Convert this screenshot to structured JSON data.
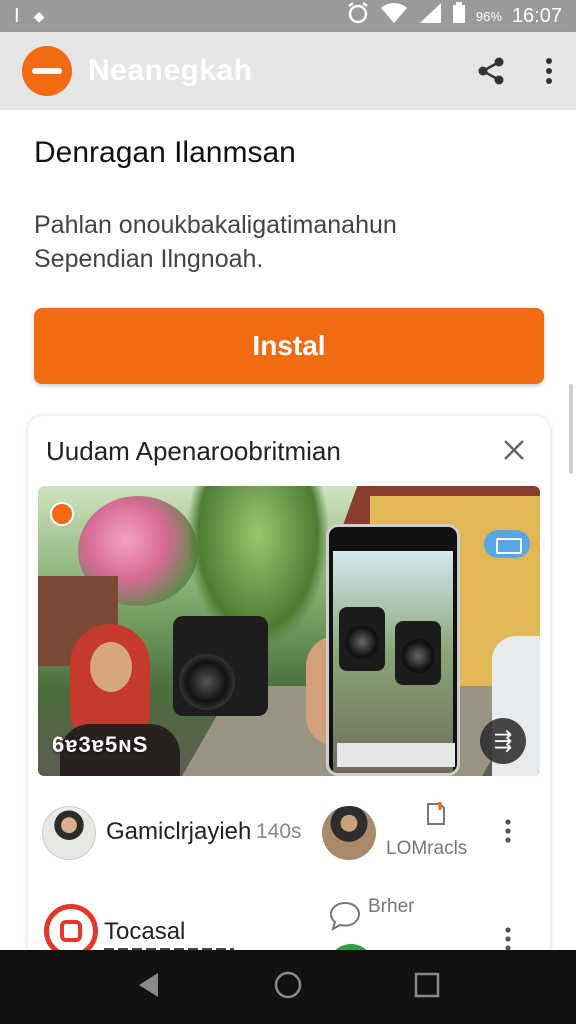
{
  "status_bar": {
    "left_glyph": "I",
    "carrier_glyph": "◆",
    "battery_label": "96%",
    "time": "16:07"
  },
  "app_bar": {
    "title": "Neanegkah"
  },
  "main": {
    "heading": "Denragan Ilanmsan",
    "description": [
      "Pahlan onoukbakaligatimanahun",
      "Sependian Ilngnoah."
    ],
    "install_label": "Instal"
  },
  "card": {
    "title": "Uudam Apenaroobritmian",
    "media_overlay_text": "6ɐ3ɐ5ɴS",
    "fab_label": "⇶"
  },
  "list": [
    {
      "name": "Gamiclrjayieh",
      "meta": "140s",
      "secondary": "LOMracls"
    },
    {
      "name": "Tocasal",
      "secondary": "Brher"
    }
  ],
  "colors": {
    "accent": "#f26a12",
    "statusbar": "#9a9a9a",
    "appbar": "#e6e6e6",
    "navbar": "#111111"
  }
}
